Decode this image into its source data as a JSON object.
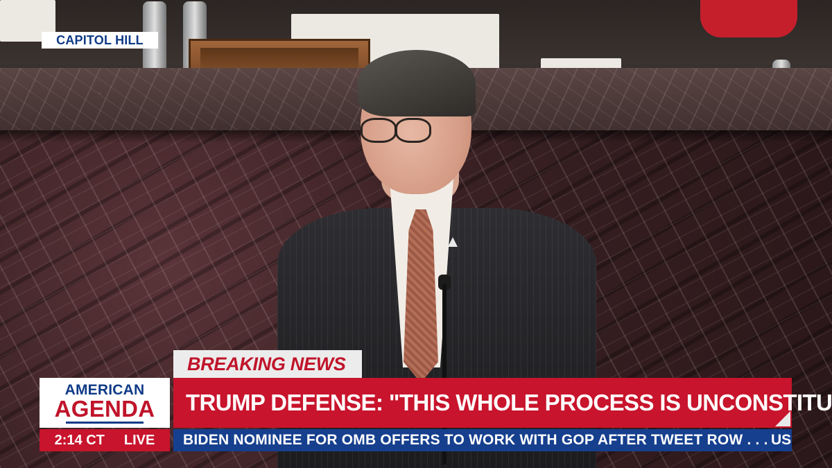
{
  "location": {
    "label": "CAPITOL HILL"
  },
  "banner": {
    "breaking_label": "BREAKING NEWS"
  },
  "logo": {
    "line1": "AMERICAN",
    "line2": "AGENDA"
  },
  "headline": {
    "text": "TRUMP DEFENSE: \"THIS WHOLE PROCESS IS UNCONSTITUTIONAL\""
  },
  "clock": {
    "time": "2:14 CT",
    "live_label": "LIVE"
  },
  "ticker": {
    "text": "BIDEN NOMINEE FOR OMB OFFERS TO WORK WITH GOP AFTER TWEET ROW . . .",
    "next_label": "US"
  },
  "colors": {
    "brand_blue": "#0e3a86",
    "brand_red": "#c8142c",
    "ticker_blue": "#163f8e"
  }
}
